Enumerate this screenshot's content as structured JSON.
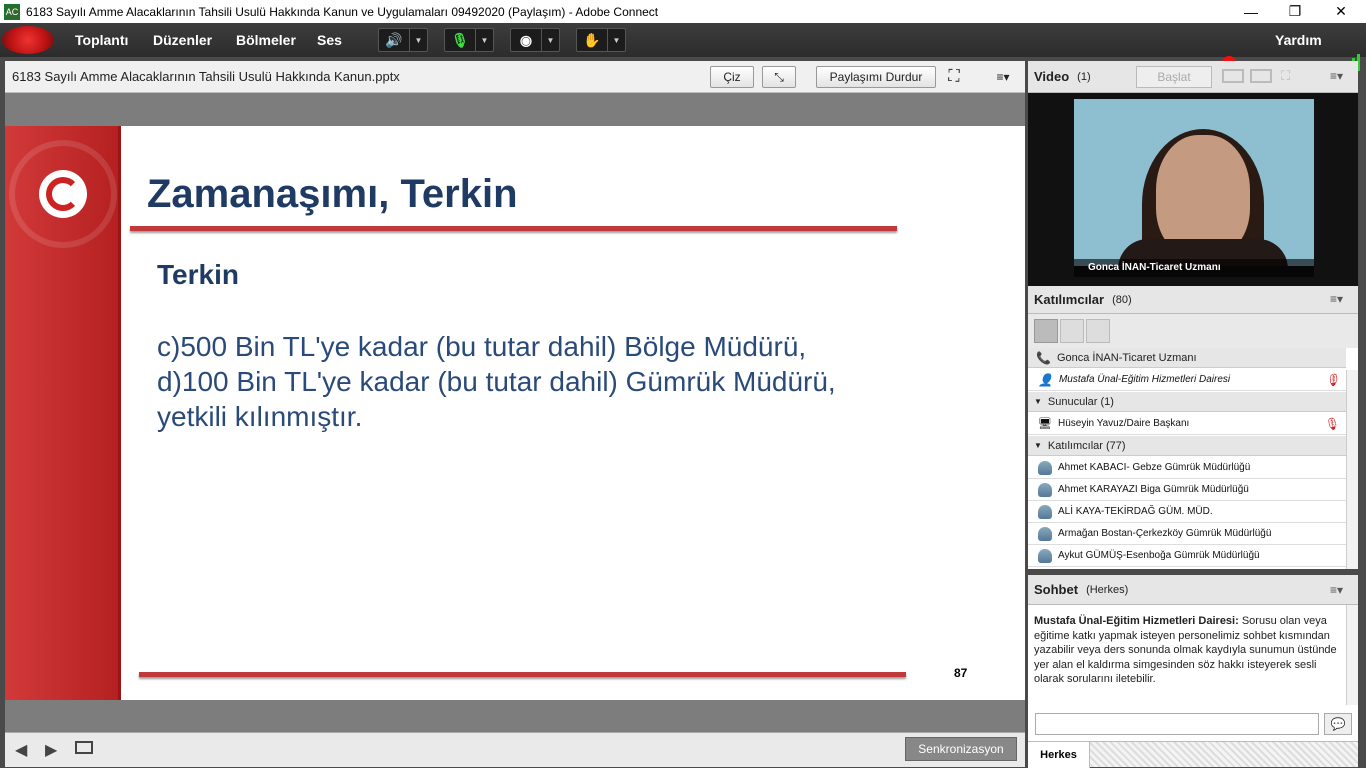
{
  "window": {
    "title": "6183 Sayılı Amme Alacaklarının Tahsili Usulü Hakkında Kanun ve Uygulamaları 09492020 (Paylaşım) - Adobe Connect",
    "minimize": "—",
    "restore": "❐",
    "close": "✕"
  },
  "menu": {
    "items": [
      "Toplantı",
      "Düzenler",
      "Bölmeler",
      "Ses"
    ],
    "help": "Yardım"
  },
  "share": {
    "title": "6183 Sayılı Amme Alacaklarının Tahsili Usulü Hakkında Kanun.pptx",
    "draw": "Çiz",
    "stop": "Paylaşımı Durdur",
    "sync": "Senkronizasyon"
  },
  "slide": {
    "title": "Zamanaşımı, Terkin",
    "subtitle": "Terkin",
    "lines": [
      "c)500 Bin TL'ye kadar (bu tutar dahil) Bölge Müdürü,",
      "d)100 Bin TL'ye kadar (bu tutar dahil) Gümrük Müdürü,",
      "yetkili kılınmıştır."
    ],
    "page": "87"
  },
  "video": {
    "title": "Video",
    "count": "(1)",
    "start": "Başlat",
    "caption": "Gonca İNAN-Ticaret Uzmanı"
  },
  "participants": {
    "title": "Katılımcılar",
    "count": "(80)",
    "speaker": "Gonca İNAN-Ticaret Uzmanı",
    "host": "Mustafa Ünal-Eğitim Hizmetleri Dairesi",
    "presenters_label": "Sunucular (1)",
    "presenter": "Hüseyin Yavuz/Daire Başkanı",
    "attendees_label": "Katılımcılar (77)",
    "attendees": [
      "Ahmet KABACI- Gebze Gümrük Müdürlüğü",
      "Ahmet KARAYAZI Biga Gümrük Müdürlüğü",
      "ALİ KAYA-TEKİRDAĞ GÜM. MÜD.",
      "Armağan Bostan-Çerkezköy Gümrük Müdürlüğü",
      "Aykut GÜMÜŞ-Esenboğa Gümrük Müdürlüğü"
    ]
  },
  "chat": {
    "title": "Sohbet",
    "scope": "(Herkes)",
    "sender": "Mustafa Ünal-Eğitim Hizmetleri Dairesi:",
    "message": " Sorusu olan veya eğitime katkı yapmak isteyen personelimiz sohbet kısmından yazabilir veya ders sonunda olmak kaydıyla sunumun üstünde yer alan el kaldırma simgesinden söz hakkı isteyerek sesli olarak sorularını iletebilir.",
    "tab": "Herkes",
    "input_value": ""
  }
}
